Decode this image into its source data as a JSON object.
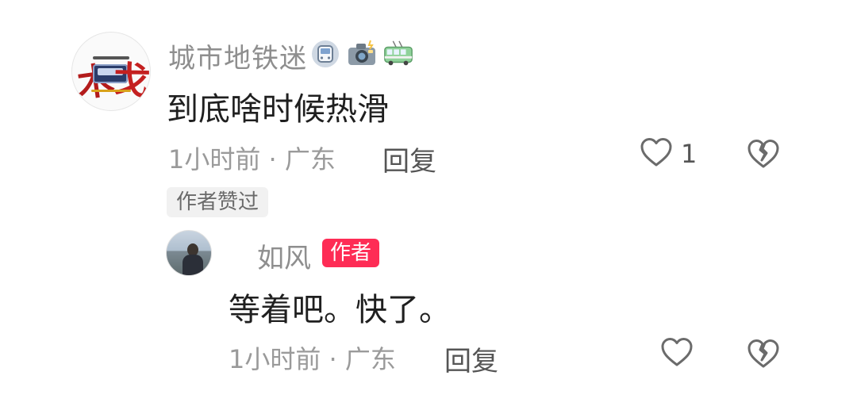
{
  "comment": {
    "username": "城市地铁迷",
    "emojis": [
      "metro-train-icon",
      "camera-flash-icon",
      "trolleybus-icon"
    ],
    "text": "到底啥时候热滑",
    "time_location": "1小时前 · 广东",
    "reply_label": "回复",
    "like_count": "1",
    "author_liked_badge": "作者赞过"
  },
  "reply": {
    "username": "如风",
    "author_badge": "作者",
    "text": "等着吧。快了。",
    "time_location": "1小时前 · 广东",
    "reply_label": "回复",
    "like_count": ""
  },
  "colors": {
    "author_badge_bg": "#fe2c55",
    "username": "#8e8e8e",
    "meta": "#9a9a9a",
    "text": "#1f1f1f"
  }
}
